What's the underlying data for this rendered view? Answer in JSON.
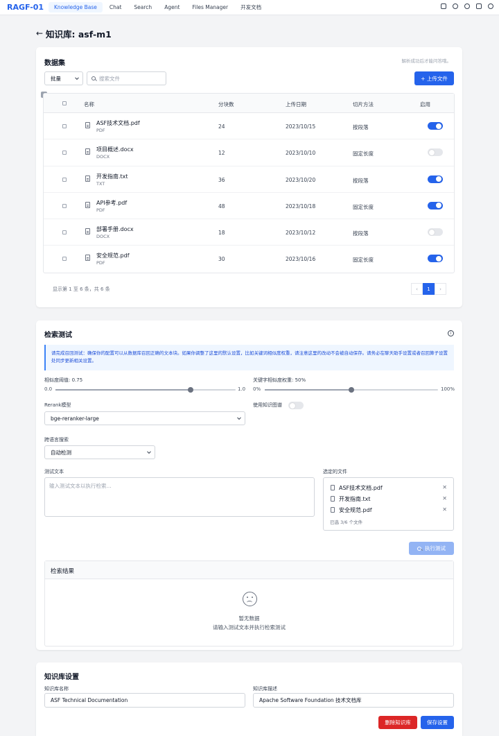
{
  "app": {
    "logo": "RAGF-01",
    "nav": [
      "Knowledge Base",
      "Chat",
      "Search",
      "Agent",
      "Files Manager",
      "开发文档"
    ],
    "active_nav": "Knowledge Base",
    "top_icons": [
      "github-icon",
      "help-icon",
      "settings-icon",
      "home-icon",
      "user-icon"
    ]
  },
  "page": {
    "back_icon": "←",
    "title": "知识库: asf-m1"
  },
  "dataset": {
    "title": "数据集",
    "hint": "解析成功后才能问答哦。",
    "bulk_select": "批量",
    "search_placeholder": "搜索文件",
    "upload_label": "+ 上传文件",
    "columns": [
      "名称",
      "分块数",
      "上传日期",
      "切片方法",
      "启用"
    ],
    "rows": [
      {
        "name": "ASF技术文档.pdf",
        "type": "PDF",
        "chunks": "24",
        "date": "2023/10/15",
        "method": "按段落",
        "enabled": true
      },
      {
        "name": "项目概述.docx",
        "type": "DOCX",
        "chunks": "12",
        "date": "2023/10/10",
        "method": "固定长度",
        "enabled": false
      },
      {
        "name": "开发指南.txt",
        "type": "TXT",
        "chunks": "36",
        "date": "2023/10/20",
        "method": "按段落",
        "enabled": true
      },
      {
        "name": "API参考.pdf",
        "type": "PDF",
        "chunks": "48",
        "date": "2023/10/18",
        "method": "固定长度",
        "enabled": true
      },
      {
        "name": "部署手册.docx",
        "type": "DOCX",
        "chunks": "18",
        "date": "2023/10/12",
        "method": "按段落",
        "enabled": false
      },
      {
        "name": "安全规范.pdf",
        "type": "PDF",
        "chunks": "30",
        "date": "2023/10/16",
        "method": "固定长度",
        "enabled": true
      }
    ],
    "footer": "显示第 1 至 6 条，共 6 条",
    "pagination": {
      "prev": "‹",
      "current": "1",
      "next": "›"
    }
  },
  "retrieval": {
    "title": "检索测试",
    "info_icon": "i",
    "info_text": "请完成召回测试：确保你的配置可以从数据库召回正确的文本块。如果你调整了这里的默认设置，比如关键词相似度权重，请注意这里的改动不会被自动保存。请务必在聊天助手设置或者召回算子设置处同步更新相关设置。",
    "similarity": {
      "label": "相似度阈值: 0.75",
      "value": 0.75,
      "min_label": "0.0",
      "max_label": "1.0"
    },
    "keyword_weight": {
      "label": "关键字相似度权重: 50%",
      "value": 0.5,
      "min_label": "0%",
      "max_label": "100%"
    },
    "rerank": {
      "label": "Rerank模型",
      "value": "bge-reranker-large"
    },
    "knowledge_graph": {
      "label": "使用知识图谱",
      "enabled": false
    },
    "cross_language": {
      "label": "跨语言搜索",
      "value": "自动检测"
    },
    "test_text": {
      "label": "测试文本",
      "placeholder": "输入测试文本以执行检索..."
    },
    "selected_files": {
      "label": "选定的文件",
      "items": [
        "ASF技术文档.pdf",
        "开发指南.txt",
        "安全规范.pdf"
      ],
      "count": "已选 3/6 个文件"
    },
    "run_button": "执行测试",
    "results": {
      "title": "检索结果",
      "empty_title": "暂无数据",
      "empty_desc": "请输入测试文本并执行检索测试"
    }
  },
  "settings": {
    "title": "知识库设置",
    "name_label": "知识库名称",
    "name_value": "ASF Technical Documentation",
    "desc_label": "知识库描述",
    "desc_value": "Apache Software Foundation 技术文档库",
    "delete_button": "删除知识库",
    "save_button": "保存设置"
  },
  "colors": {
    "primary": "#2563eb",
    "danger": "#dc2626",
    "info_bg": "#eff6ff"
  }
}
